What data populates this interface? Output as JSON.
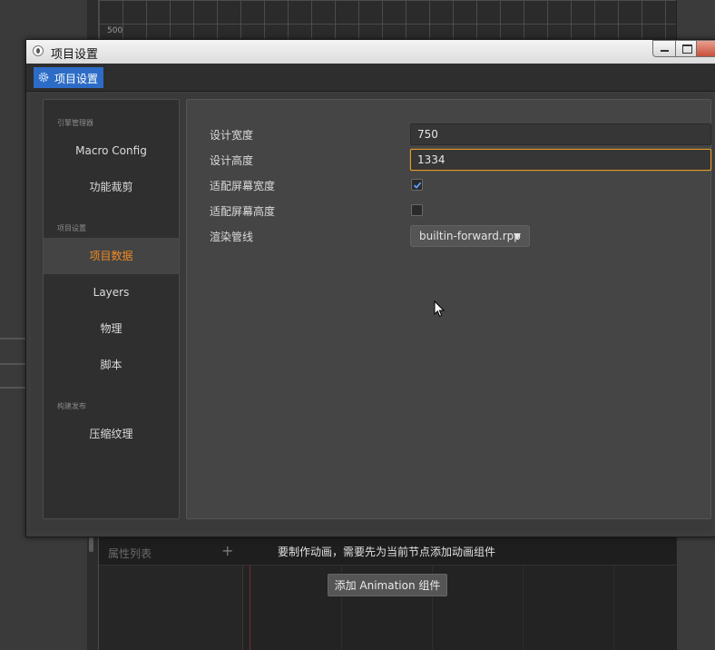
{
  "background": {
    "scene_label": "500",
    "timeline": {
      "attr_list_label": "属性列表",
      "add_symbol": "+",
      "message": "要制作动画，需要先为当前节点添加动画组件",
      "add_button_label": "添加 Animation 组件"
    }
  },
  "window": {
    "title": "项目设置",
    "tab_label": "项目设置"
  },
  "sidebar": {
    "sections": [
      {
        "title": "引擎管理器",
        "items": [
          {
            "label": "Macro Config",
            "active": false
          },
          {
            "label": "功能裁剪",
            "active": false
          }
        ]
      },
      {
        "title": "项目设置",
        "items": [
          {
            "label": "项目数据",
            "active": true
          },
          {
            "label": "Layers",
            "active": false
          },
          {
            "label": "物理",
            "active": false
          },
          {
            "label": "脚本",
            "active": false
          }
        ]
      },
      {
        "title": "构建发布",
        "items": [
          {
            "label": "压缩纹理",
            "active": false
          }
        ]
      }
    ]
  },
  "settings": {
    "design_width": {
      "label": "设计宽度",
      "value": "750"
    },
    "design_height": {
      "label": "设计高度",
      "value": "1334"
    },
    "fit_width": {
      "label": "适配屏幕宽度",
      "checked": true
    },
    "fit_height": {
      "label": "适配屏幕高度",
      "checked": false
    },
    "render_pipeline": {
      "label": "渲染管线",
      "value": "builtin-forward.rpp"
    }
  },
  "colors": {
    "accent_active": "#f08a24",
    "tab_blue": "#2d6cc6",
    "focus_border": "#e29a2a"
  }
}
